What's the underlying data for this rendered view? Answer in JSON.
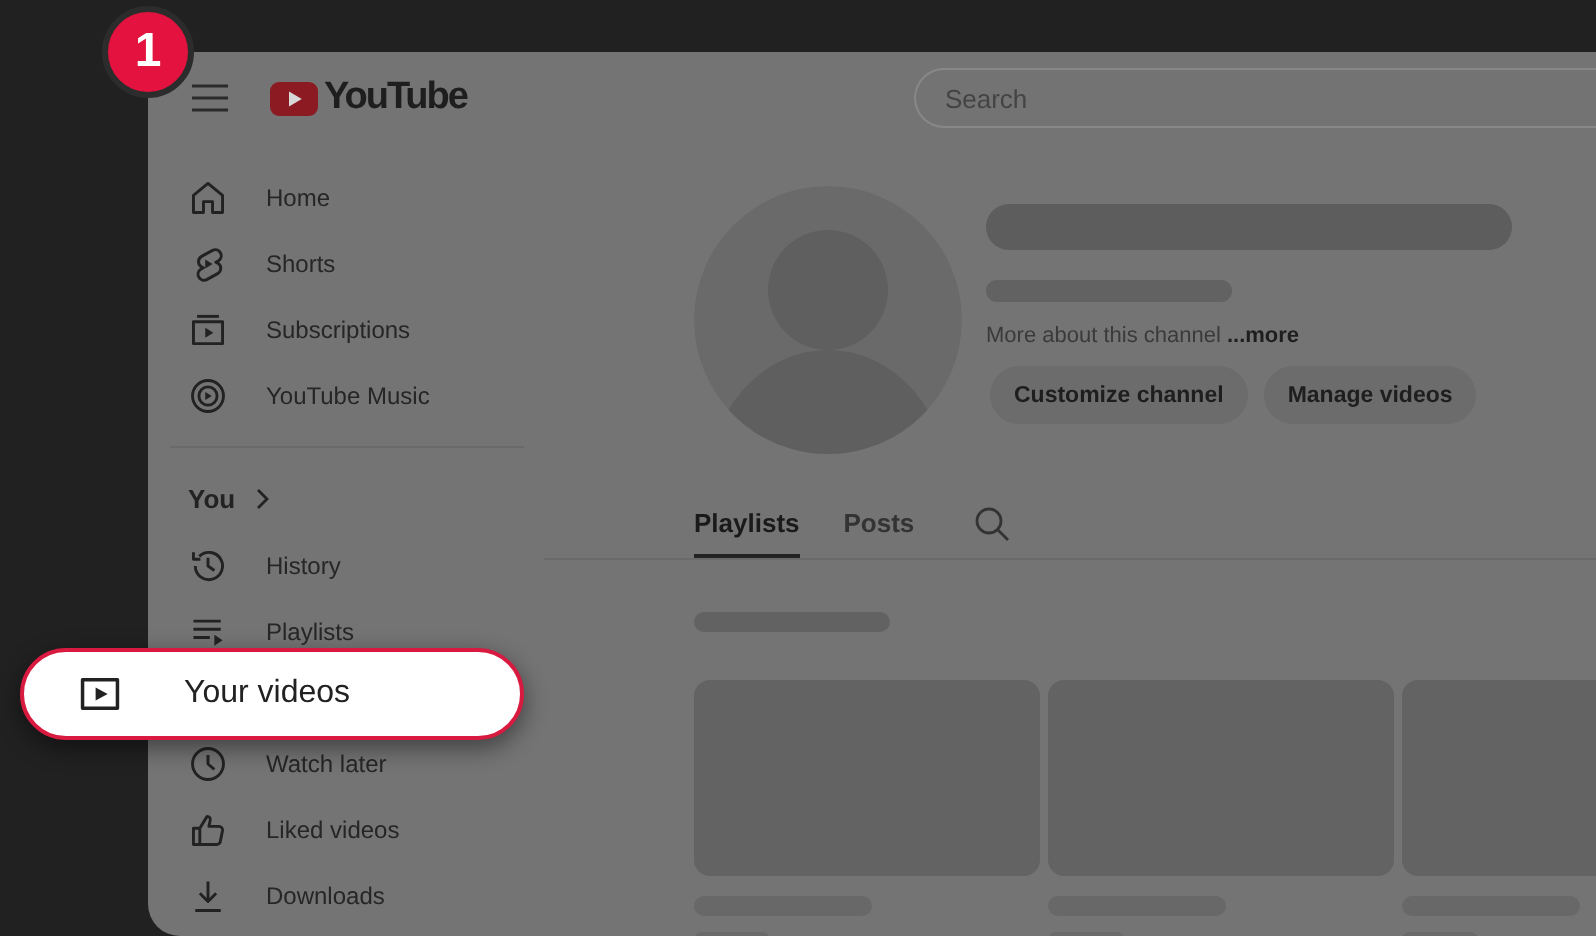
{
  "step_badge": "1",
  "header": {
    "logo": "YouTube",
    "search": {
      "placeholder": "Search"
    }
  },
  "sidebar": {
    "items": [
      {
        "label": "Home",
        "highlighted": false
      },
      {
        "label": "Shorts",
        "highlighted": false
      },
      {
        "label": "Subscriptions",
        "highlighted": false
      },
      {
        "label": "YouTube Music",
        "highlighted": false
      }
    ],
    "you_section": {
      "title": "You",
      "items": [
        {
          "label": "History",
          "highlighted": false
        },
        {
          "label": "Playlists",
          "highlighted": false
        },
        {
          "label": "Your videos",
          "highlighted": true
        },
        {
          "label": "Watch later",
          "highlighted": false
        },
        {
          "label": "Liked videos",
          "highlighted": false
        },
        {
          "label": "Downloads",
          "highlighted": false
        }
      ]
    }
  },
  "channel": {
    "description": "More about this channel",
    "more_link": "...more",
    "buttons": [
      "Customize channel",
      "Manage videos"
    ],
    "tabs": [
      {
        "label": "Playlists",
        "selected": true
      },
      {
        "label": "Posts",
        "selected": false
      }
    ]
  }
}
